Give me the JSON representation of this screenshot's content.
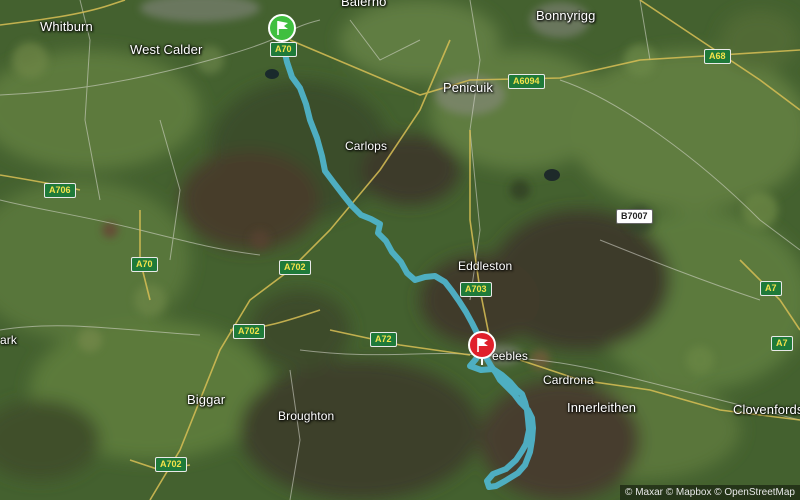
{
  "map": {
    "places": [
      {
        "id": "whitburn",
        "label": "Whitburn"
      },
      {
        "id": "west-calder",
        "label": "West Calder"
      },
      {
        "id": "balerno",
        "label": "Balerno"
      },
      {
        "id": "bonnyrigg",
        "label": "Bonnyrigg"
      },
      {
        "id": "penicuik",
        "label": "Penicuik"
      },
      {
        "id": "carlops",
        "label": "Carlops"
      },
      {
        "id": "eddleston",
        "label": "Eddleston"
      },
      {
        "id": "peebles",
        "label": "eebles"
      },
      {
        "id": "cardrona",
        "label": "Cardrona"
      },
      {
        "id": "innerleithen",
        "label": "Innerleithen"
      },
      {
        "id": "clovenfords",
        "label": "Clovenfords"
      },
      {
        "id": "biggar",
        "label": "Biggar"
      },
      {
        "id": "broughton",
        "label": "Broughton"
      },
      {
        "id": "lanark",
        "label": "ark"
      }
    ],
    "roads": {
      "a70_start": "A70",
      "a6094": "A6094",
      "a68": "A68",
      "a706": "A706",
      "a70_west": "A70",
      "a702_mid": "A702",
      "b7007": "B7007",
      "a703": "A703",
      "a7_east": "A7",
      "a7_lower": "A7",
      "a702_south": "A702",
      "a72": "A72",
      "a702_bottom": "A702"
    },
    "route": {
      "color": "#4fb3c9",
      "start_flag_color": "#3fbf3f",
      "end_flag_color": "#e0202b"
    },
    "attribution": "© Maxar © Mapbox © OpenStreetMap"
  }
}
